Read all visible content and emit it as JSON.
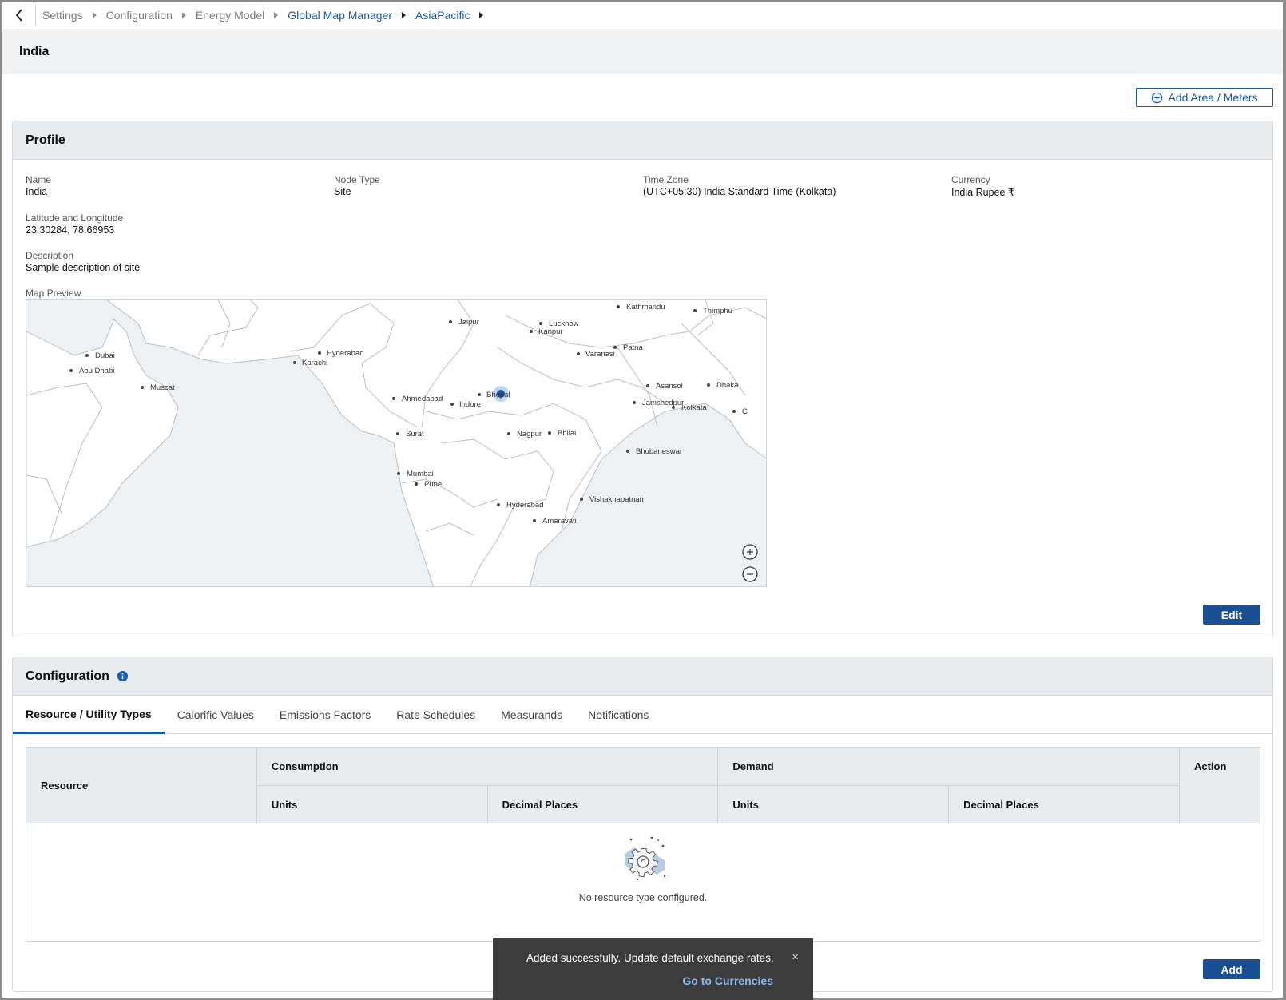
{
  "breadcrumb": {
    "items": [
      {
        "label": "Settings"
      },
      {
        "label": "Configuration"
      },
      {
        "label": "Energy Model"
      },
      {
        "label": "Global Map Manager"
      },
      {
        "label": "AsiaPacific"
      }
    ]
  },
  "page": {
    "title": "India"
  },
  "toolbar": {
    "add_area_label": "Add Area / Meters"
  },
  "profile": {
    "heading": "Profile",
    "name_label": "Name",
    "name_value": "India",
    "node_type_label": "Node Type",
    "node_type_value": "Site",
    "time_zone_label": "Time Zone",
    "time_zone_value": "(UTC+05:30) India Standard Time (Kolkata)",
    "currency_label": "Currency",
    "currency_value": "India Rupee ₹",
    "latlng_label": "Latitude and Longitude",
    "latlng_value": "23.30284, 78.66953",
    "description_label": "Description",
    "description_value": "Sample description of site",
    "map_label": "Map Preview",
    "edit_label": "Edit"
  },
  "map": {
    "cities": [
      "Kathmandu",
      "Thimphu",
      "Jaipur",
      "Lucknow",
      "Kanpur",
      "Dubai",
      "Abu Dhabi",
      "Hyderabad",
      "Karachi",
      "Varanasi",
      "Patna",
      "Muscat",
      "Ahmedabad",
      "Indore",
      "Bhopal",
      "Asansol",
      "Dhaka",
      "Jamshedpur",
      "Kolkata",
      "C",
      "Surat",
      "Nagpur",
      "Bhilai",
      "Bhubaneswar",
      "Mumbai",
      "Pune",
      "Hyderabad",
      "Vishakhapatnam",
      "Amaravati"
    ],
    "zoom_in_icon": "plus-circle-icon",
    "zoom_out_icon": "minus-circle-icon"
  },
  "configuration": {
    "heading": "Configuration",
    "info_icon": "info-icon",
    "tabs": [
      {
        "label": "Resource / Utility Types",
        "active": true
      },
      {
        "label": "Calorific Values"
      },
      {
        "label": "Emissions Factors"
      },
      {
        "label": "Rate Schedules"
      },
      {
        "label": "Measurands"
      },
      {
        "label": "Notifications"
      }
    ],
    "table": {
      "resource": "Resource",
      "consumption": "Consumption",
      "demand": "Demand",
      "action": "Action",
      "units": "Units",
      "decimal_places": "Decimal Places"
    },
    "empty_text": "No resource type configured.",
    "add_label": "Add"
  },
  "toast": {
    "message": "Added successfully. Update default exchange rates.",
    "link": "Go to Currencies",
    "close": "×"
  },
  "colors": {
    "accent": "#1a5aa6",
    "primary_button": "#1a4f93",
    "header_bg": "#e9ecef",
    "toast_bg": "#3c3c3c"
  }
}
